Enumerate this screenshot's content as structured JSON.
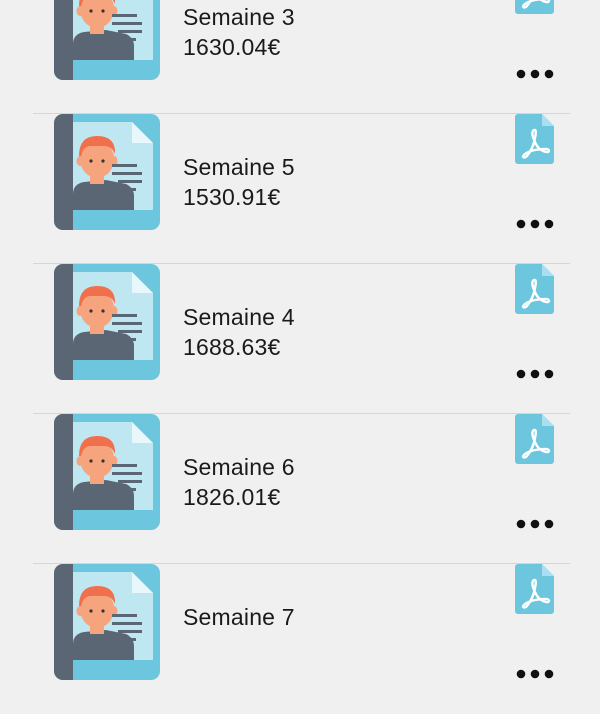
{
  "payslips": [
    {
      "title": "Semaine 3",
      "amount": "1630.04€"
    },
    {
      "title": "Semaine 5",
      "amount": "1530.91€"
    },
    {
      "title": "Semaine 4",
      "amount": "1688.63€"
    },
    {
      "title": "Semaine 6",
      "amount": "1826.01€"
    },
    {
      "title": "Semaine 7",
      "amount": ""
    }
  ],
  "icons": {
    "avatar": "employee-document-icon",
    "file": "pdf-file-icon",
    "menu": "more-options-icon"
  },
  "colors": {
    "background": "#f0f0f0",
    "divider": "#d6d6d6",
    "accent_blue": "#6cc6dd",
    "text": "#1a1a1a"
  }
}
